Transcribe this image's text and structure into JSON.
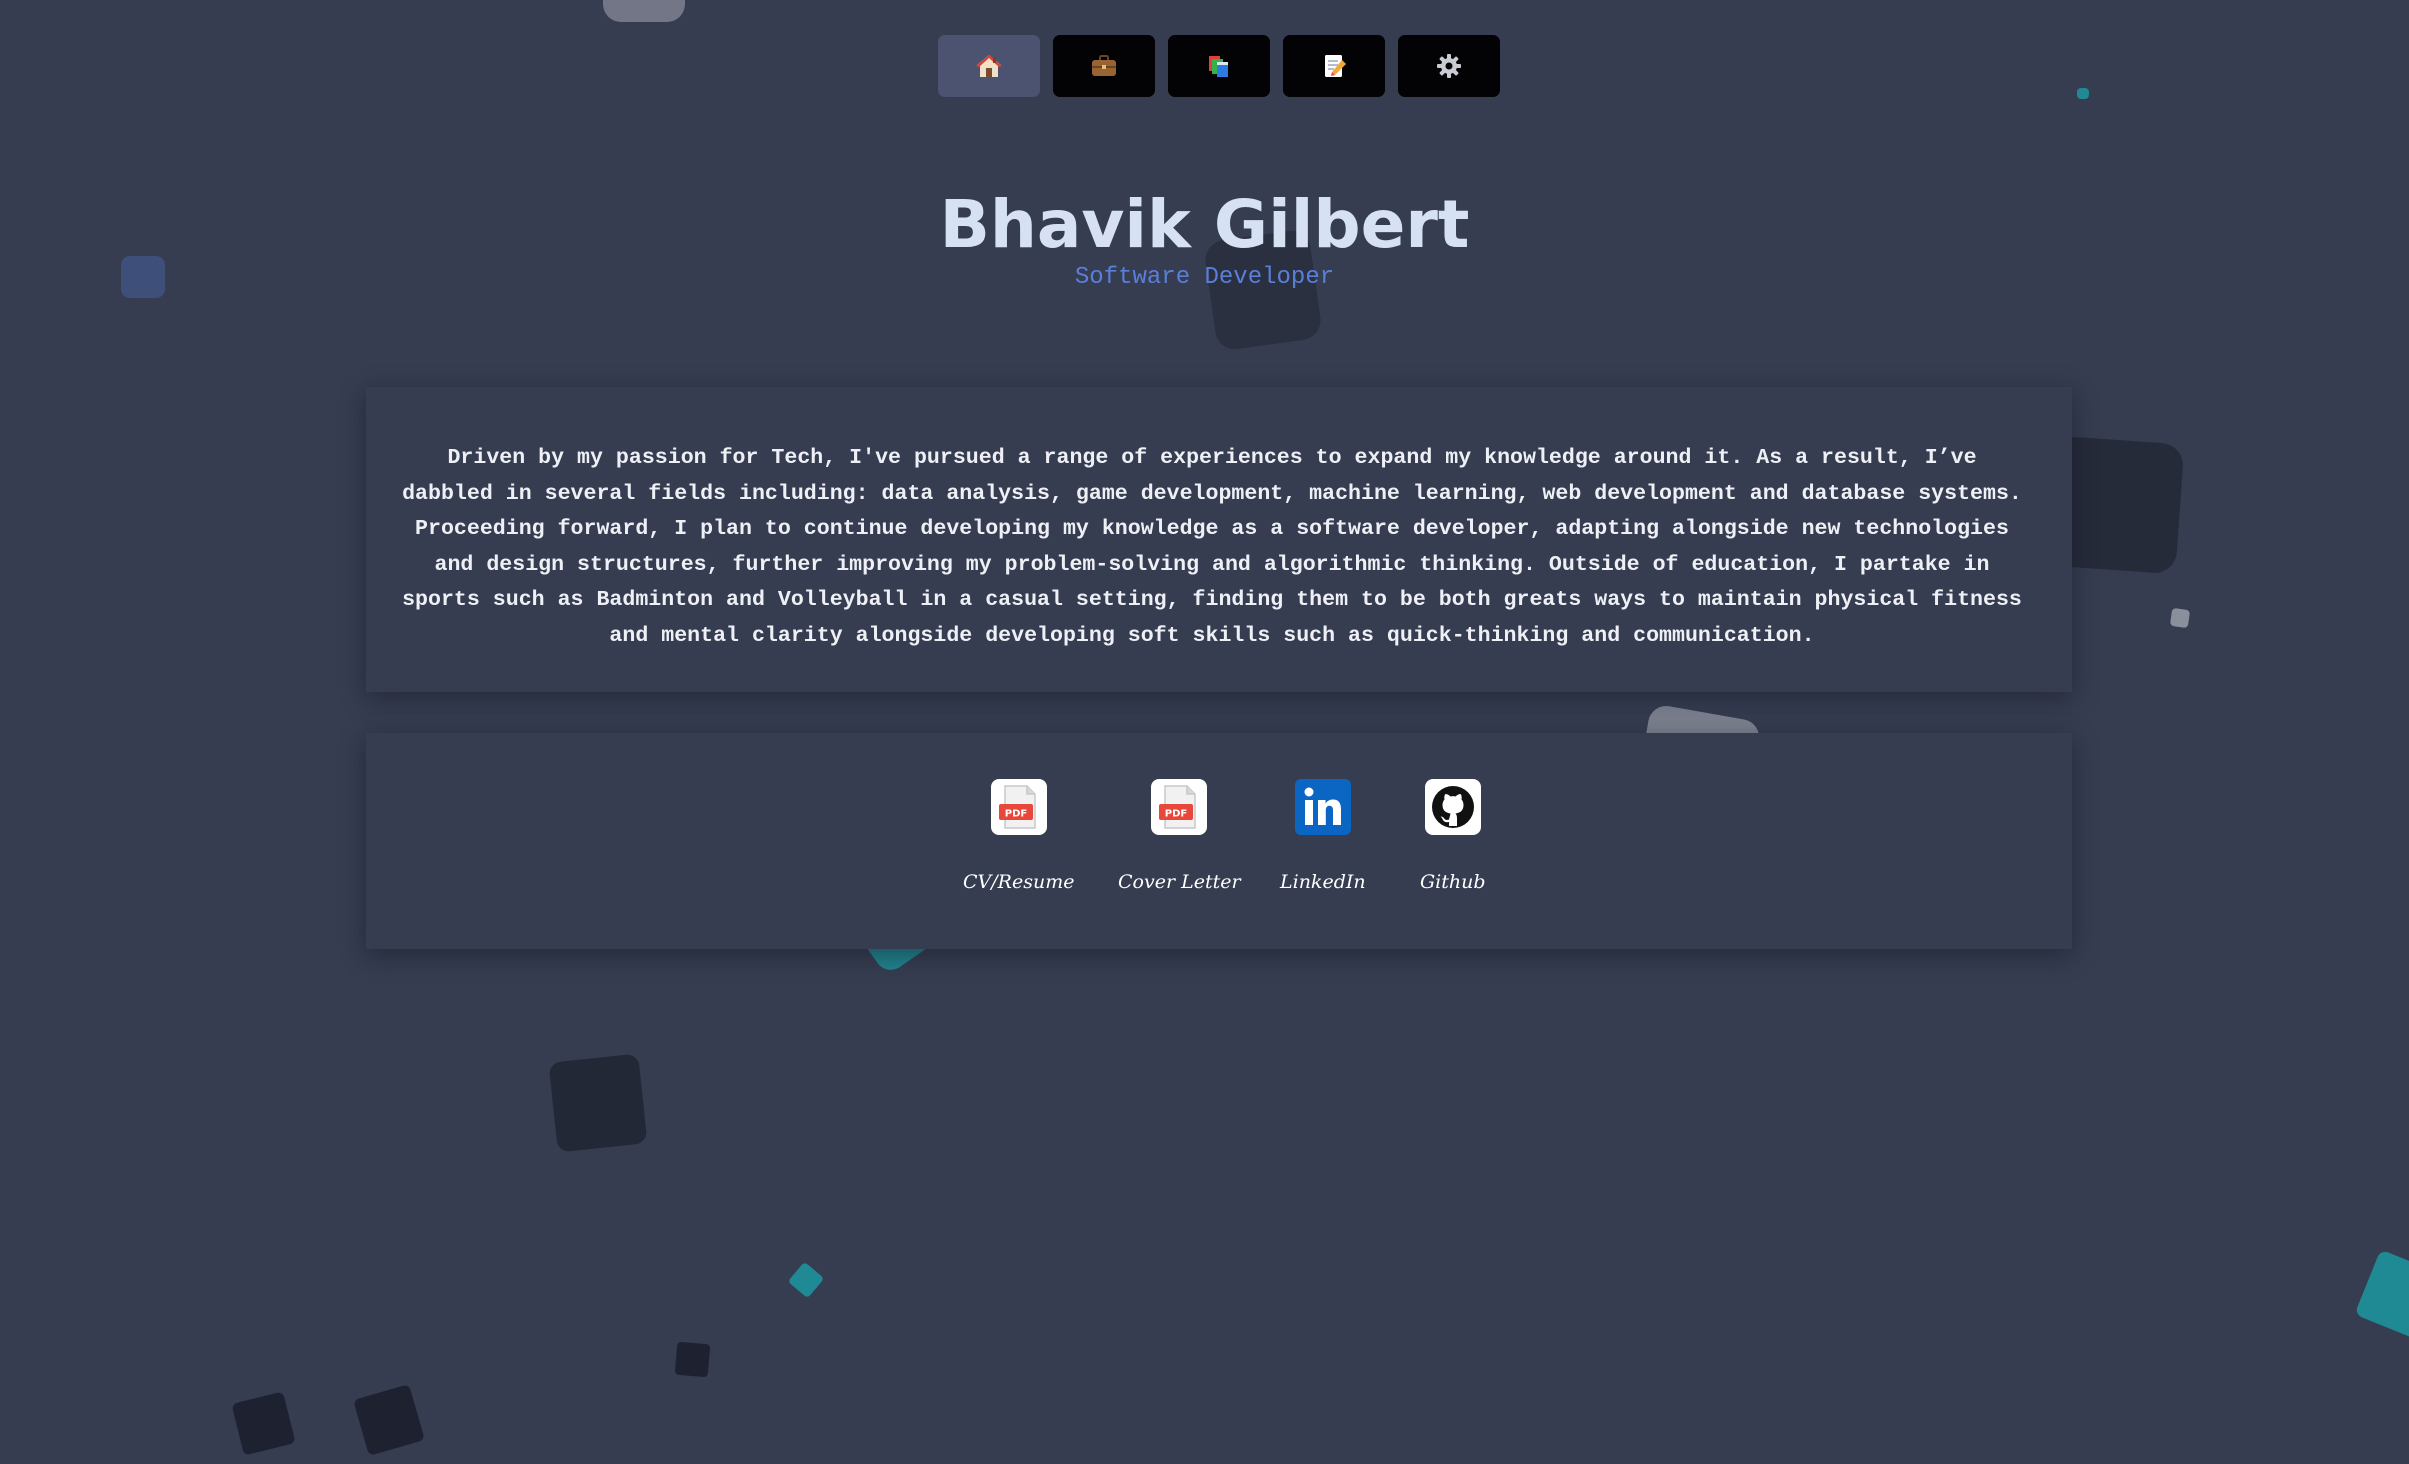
{
  "nav": {
    "items": [
      {
        "name": "home",
        "icon": "house-icon",
        "active": true
      },
      {
        "name": "work",
        "icon": "briefcase-icon",
        "active": false
      },
      {
        "name": "projects",
        "icon": "books-icon",
        "active": false
      },
      {
        "name": "notes",
        "icon": "memo-icon",
        "active": false
      },
      {
        "name": "settings",
        "icon": "gear-icon",
        "active": false
      }
    ]
  },
  "header": {
    "name": "Bhavik Gilbert",
    "role": "Software Developer"
  },
  "about": {
    "text": "Driven by my passion for Tech, I've pursued a range of experiences to expand my knowledge around it. As a result, I’ve dabbled in several fields including: data analysis, game development, machine learning, web development and database systems. Proceeding forward, I plan to continue developing my knowledge as a software developer, adapting alongside new technologies and design structures, further improving my problem-solving and algorithmic thinking.  Outside of education, I partake in sports such as Badminton and Volleyball in a casual setting, finding them to be both greats ways to maintain physical fitness and mental clarity alongside developing soft skills such as quick-thinking and communication."
  },
  "links": [
    {
      "label": "CV/Resume",
      "icon": "pdf-icon"
    },
    {
      "label": "Cover Letter",
      "icon": "pdf-icon"
    },
    {
      "label": "LinkedIn",
      "icon": "linkedin-icon"
    },
    {
      "label": "Github",
      "icon": "github-icon"
    }
  ],
  "colors": {
    "background": "#363d51",
    "title": "#d6e1f4",
    "subtitle": "#5a7fd8",
    "accent_teal": "#1f8a94",
    "nav_active": "#4b5370",
    "nav_inactive": "#030305"
  }
}
